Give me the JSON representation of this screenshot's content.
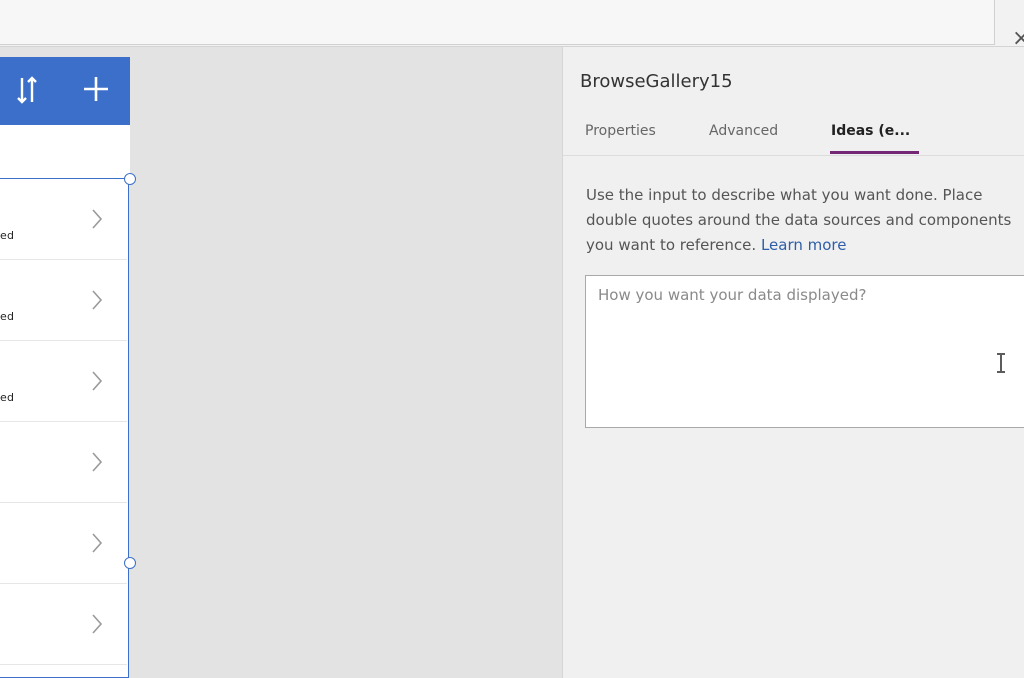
{
  "topbar": {
    "close_glyph": "×"
  },
  "canvas": {
    "header_icons": [
      "sort-icon",
      "add-icon"
    ],
    "gallery": {
      "rows": [
        {
          "label": "ed"
        },
        {
          "label": "ed"
        },
        {
          "label": "ed"
        },
        {
          "label": ""
        },
        {
          "label": ""
        },
        {
          "label": ""
        }
      ]
    },
    "colors": {
      "accent": "#3c6fc9"
    }
  },
  "panel": {
    "kicker": "",
    "control_name": "BrowseGallery15",
    "tabs": [
      {
        "label": "Properties",
        "active": false
      },
      {
        "label": "Advanced",
        "active": false
      },
      {
        "label": "Ideas (e...",
        "active": true
      }
    ],
    "description": "Use the input to describe what you want done. Place double quotes around the data sources and components you want to reference.",
    "learn_more": "Learn more",
    "input": {
      "value": "",
      "placeholder": "How you want your data displayed?"
    },
    "colors": {
      "tab_accent": "#742774",
      "link": "#2e5ea8"
    }
  }
}
